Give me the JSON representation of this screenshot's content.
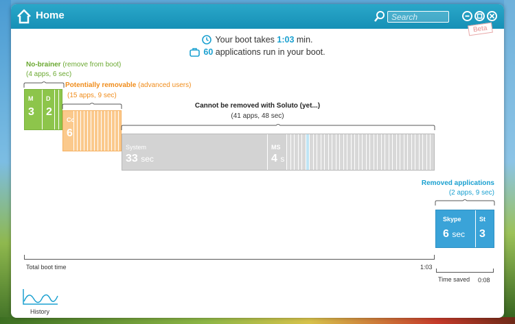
{
  "window": {
    "title": "Home"
  },
  "search": {
    "placeholder": "Search"
  },
  "badge": {
    "beta": "Beta"
  },
  "summary": {
    "boot_prefix": "Your boot takes ",
    "boot_time": "1:03",
    "boot_suffix": " min.",
    "apps_count": "60",
    "apps_suffix": " applications run in your boot."
  },
  "groups": {
    "no_brainer": {
      "title": "No-brainer",
      "subtitle": " (remove from boot)",
      "detail": "(4 apps, 6 sec)",
      "color": "#8dc54b"
    },
    "removable": {
      "title": "Potentially removable",
      "subtitle": " (advanced users)",
      "detail": "(15 apps, 9 sec)",
      "color": "#f39a2a"
    },
    "cannot": {
      "title": "Cannot be removed with Soluto (yet...)",
      "detail": "(41 apps, 48 sec)",
      "color": "#d8d8d8"
    },
    "removed": {
      "title": "Removed applications",
      "detail": "(2 apps, 9 sec)",
      "color": "#3aa3d8"
    }
  },
  "blocks": {
    "no_brainer": [
      {
        "name": "M",
        "value": "3"
      },
      {
        "name": "D",
        "value": "2"
      }
    ],
    "removable": [
      {
        "name": "Co",
        "value": "6"
      }
    ],
    "cannot": [
      {
        "name": "System",
        "value": "33",
        "unit": "sec"
      },
      {
        "name": "MS",
        "value": "4",
        "unit": "s"
      }
    ],
    "removed": [
      {
        "name": "Skype",
        "value": "6",
        "unit": "sec"
      },
      {
        "name": "St",
        "value": "3"
      }
    ]
  },
  "axis": {
    "total_label": "Total boot time",
    "total_value": "1:03",
    "saved_label": "Time saved",
    "saved_value": "0:08"
  },
  "history": {
    "label": "History"
  },
  "colors": {
    "accent": "#1aa0d0",
    "titlebar": "#1a98c0"
  }
}
